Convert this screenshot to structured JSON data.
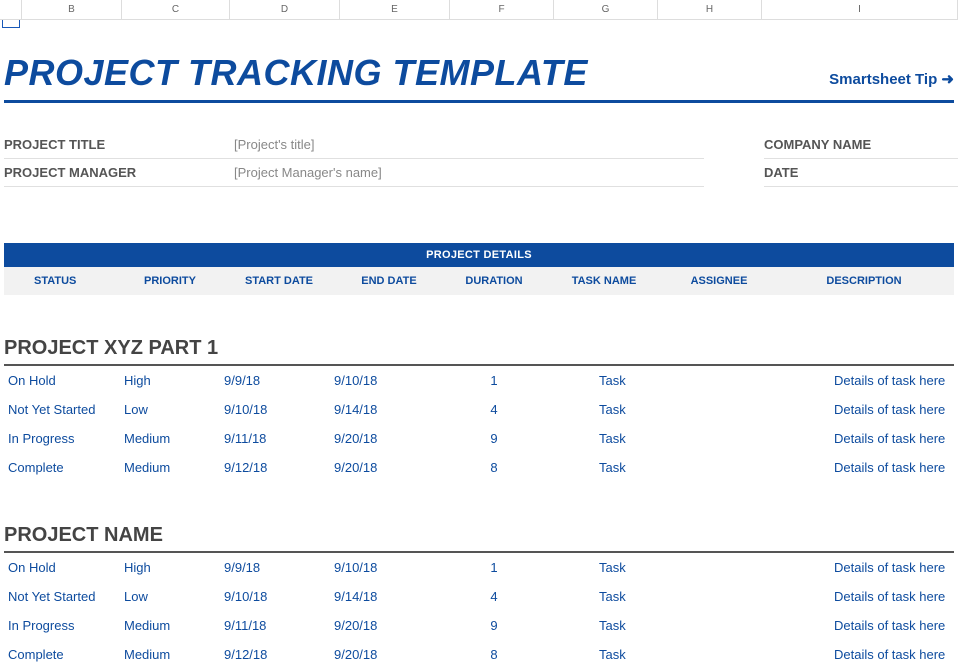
{
  "columns": [
    "B",
    "C",
    "D",
    "E",
    "F",
    "G",
    "H",
    "I"
  ],
  "title": "PROJECT TRACKING TEMPLATE",
  "tip_label": "Smartsheet Tip ➜",
  "meta": {
    "left": [
      {
        "label": "PROJECT TITLE",
        "value": "[Project's title]"
      },
      {
        "label": "PROJECT MANAGER",
        "value": "[Project Manager's name]"
      }
    ],
    "right": [
      {
        "label": "COMPANY NAME",
        "value": ""
      },
      {
        "label": "DATE",
        "value": ""
      }
    ]
  },
  "details_band": "PROJECT DETAILS",
  "headers": {
    "status": "STATUS",
    "priority": "PRIORITY",
    "start": "START DATE",
    "end": "END DATE",
    "duration": "DURATION",
    "task": "TASK NAME",
    "assignee": "ASSIGNEE",
    "desc": "DESCRIPTION"
  },
  "sections": [
    {
      "title": "PROJECT XYZ PART 1",
      "rows": [
        {
          "status": "On Hold",
          "priority": "High",
          "start": "9/9/18",
          "end": "9/10/18",
          "duration": "1",
          "task": "Task",
          "assignee": "",
          "desc": "Details of task here"
        },
        {
          "status": "Not Yet Started",
          "priority": "Low",
          "start": "9/10/18",
          "end": "9/14/18",
          "duration": "4",
          "task": "Task",
          "assignee": "",
          "desc": "Details of task here"
        },
        {
          "status": "In Progress",
          "priority": "Medium",
          "start": "9/11/18",
          "end": "9/20/18",
          "duration": "9",
          "task": "Task",
          "assignee": "",
          "desc": "Details of task here"
        },
        {
          "status": "Complete",
          "priority": "Medium",
          "start": "9/12/18",
          "end": "9/20/18",
          "duration": "8",
          "task": "Task",
          "assignee": "",
          "desc": "Details of task here"
        }
      ]
    },
    {
      "title": "PROJECT NAME",
      "rows": [
        {
          "status": "On Hold",
          "priority": "High",
          "start": "9/9/18",
          "end": "9/10/18",
          "duration": "1",
          "task": "Task",
          "assignee": "",
          "desc": "Details of task here"
        },
        {
          "status": "Not Yet Started",
          "priority": "Low",
          "start": "9/10/18",
          "end": "9/14/18",
          "duration": "4",
          "task": "Task",
          "assignee": "",
          "desc": "Details of task here"
        },
        {
          "status": "In Progress",
          "priority": "Medium",
          "start": "9/11/18",
          "end": "9/20/18",
          "duration": "9",
          "task": "Task",
          "assignee": "",
          "desc": "Details of task here"
        },
        {
          "status": "Complete",
          "priority": "Medium",
          "start": "9/12/18",
          "end": "9/20/18",
          "duration": "8",
          "task": "Task",
          "assignee": "",
          "desc": "Details of task here"
        }
      ]
    }
  ]
}
